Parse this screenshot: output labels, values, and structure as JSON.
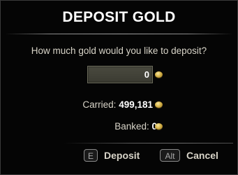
{
  "dialog": {
    "title": "DEPOSIT GOLD",
    "prompt": "How much gold would you like to deposit?",
    "amount_value": "0",
    "carried_label": "Carried: ",
    "carried_value": "499,181",
    "banked_label": "Banked: ",
    "banked_value": "0",
    "currency_icon": "gold-coin-icon"
  },
  "buttons": {
    "deposit_key": "E",
    "deposit_label": "Deposit",
    "cancel_key": "Alt",
    "cancel_label": "Cancel"
  },
  "colors": {
    "background": "#050505",
    "title": "#ffffff",
    "text": "#d8d4c8",
    "gold": "#d6b34a"
  }
}
